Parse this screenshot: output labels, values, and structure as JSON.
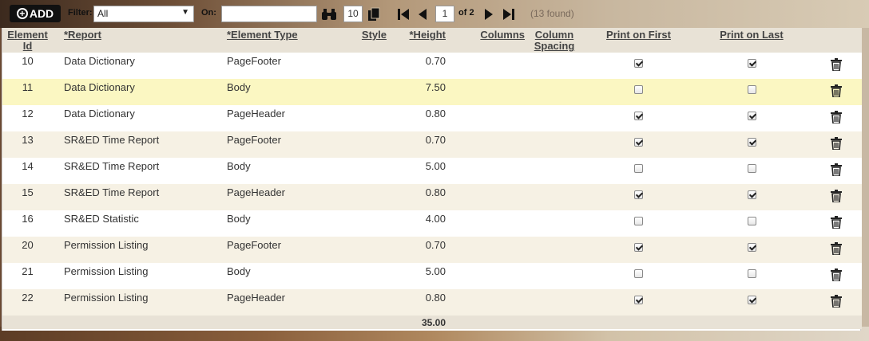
{
  "toolbar": {
    "add_label": "ADD",
    "filter_label": "Filter:",
    "filter_value": "All",
    "on_label": "On:",
    "on_value": "",
    "page_size": "10",
    "current_page": "1",
    "of_pages": "of 2",
    "found_text": "(13 found)"
  },
  "columns": {
    "id": "Element Id",
    "report": "*Report",
    "type": "*Element Type",
    "style": "Style",
    "height": "*Height",
    "columns": "Columns",
    "spacing": "Column Spacing",
    "print_first": "Print on First",
    "print_last": "Print on Last"
  },
  "rows": [
    {
      "id": "10",
      "report": "Data Dictionary",
      "type": "PageFooter",
      "height": "0.70",
      "first": true,
      "last": true
    },
    {
      "id": "11",
      "report": "Data Dictionary",
      "type": "Body",
      "height": "7.50",
      "first": false,
      "last": false
    },
    {
      "id": "12",
      "report": "Data Dictionary",
      "type": "PageHeader",
      "height": "0.80",
      "first": true,
      "last": true
    },
    {
      "id": "13",
      "report": "SR&ED Time Report",
      "type": "PageFooter",
      "height": "0.70",
      "first": true,
      "last": true
    },
    {
      "id": "14",
      "report": "SR&ED Time Report",
      "type": "Body",
      "height": "5.00",
      "first": false,
      "last": false
    },
    {
      "id": "15",
      "report": "SR&ED Time Report",
      "type": "PageHeader",
      "height": "0.80",
      "first": true,
      "last": true
    },
    {
      "id": "16",
      "report": "SR&ED Statistic",
      "type": "Body",
      "height": "4.00",
      "first": false,
      "last": false
    },
    {
      "id": "20",
      "report": "Permission Listing",
      "type": "PageFooter",
      "height": "0.70",
      "first": true,
      "last": true
    },
    {
      "id": "21",
      "report": "Permission Listing",
      "type": "Body",
      "height": "5.00",
      "first": false,
      "last": false
    },
    {
      "id": "22",
      "report": "Permission Listing",
      "type": "PageHeader",
      "height": "0.80",
      "first": true,
      "last": true
    }
  ],
  "total_height": "35.00",
  "icons": {
    "add": "plus-circle-icon",
    "search": "binoculars-icon",
    "copy": "copy-icon",
    "first": "first-page-icon",
    "prev": "prev-page-icon",
    "next": "next-page-icon",
    "last": "last-page-icon",
    "delete": "trash-icon"
  },
  "colors": {
    "highlight_row": "#fbf7c2",
    "even_row": "#f6f1e4",
    "header_bg": "#e8e2d6"
  }
}
